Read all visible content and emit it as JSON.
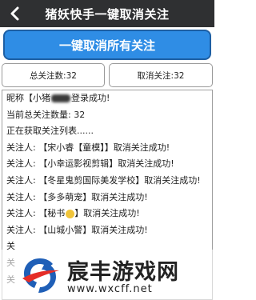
{
  "header": {
    "title": "猪妖快手一键取消关注",
    "back_icon": "chevron-left-icon"
  },
  "actions": {
    "main_button_label": "一键取消所有关注"
  },
  "stats": {
    "total_label": "总关注数:32",
    "unfollowed_label": "取消关注:32"
  },
  "log": {
    "login_prefix": "昵称【小猪",
    "login_suffix": "登录成功!",
    "total_line": "当前总关注数量: 32",
    "fetching_line": "正在获取关注列表......",
    "entries": [
      "关注人: 【宋小睿【童模】】取消关注成功!",
      "关注人: 【小幸运影视剪辑】取消关注成功!",
      "关注人: 【冬星鬼剪国际美发学校】取消关注成功!",
      "关注人: 【多多萌宠】取消关注成功!",
      "关注人: 【秘书",
      "关注人: 【山城小警】取消关注成功!",
      "关",
      "关",
      "关"
    ],
    "secretary_suffix": "】取消关注成功!"
  },
  "watermark": {
    "title": "宸丰游戏网",
    "url": "www.wxcff.net"
  },
  "colors": {
    "titlebar": "#2f3032",
    "main_button": "#2f8de5",
    "logo_blue": "#1f5fb7",
    "logo_red": "#e52d27"
  }
}
